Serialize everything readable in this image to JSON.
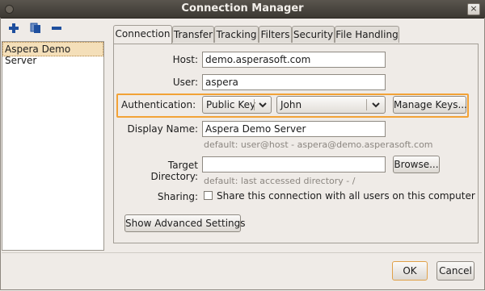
{
  "window": {
    "title": "Connection Manager",
    "close_glyph": "×"
  },
  "toolbar": {
    "icons": [
      "add-icon",
      "duplicate-icon",
      "remove-icon"
    ],
    "icon_color": "#1f4f9e"
  },
  "servers": [
    "Aspera Demo Server"
  ],
  "tabs": [
    "Connection",
    "Transfer",
    "Tracking",
    "Filters",
    "Security",
    "File Handling"
  ],
  "form": {
    "host_label": "Host:",
    "host_value": "demo.asperasoft.com",
    "user_label": "User:",
    "user_value": "aspera",
    "auth_label": "Authentication:",
    "auth_type": "Public Key",
    "auth_key": "John",
    "manage_keys": "Manage Keys...",
    "display_name_label": "Display Name:",
    "display_name_value": "Aspera Demo Server",
    "display_name_hint": "default: user@host - aspera@demo.asperasoft.com",
    "target_dir_label": "Target Directory:",
    "target_dir_value": "",
    "browse": "Browse...",
    "target_dir_hint": "default: last accessed directory - /",
    "sharing_label": "Sharing:",
    "sharing_text": "Share this connection with all users on this computer",
    "sharing_checked": false,
    "advanced": "Show Advanced Settings",
    "highlight_color": "#f2a236"
  },
  "footer": {
    "ok": "OK",
    "cancel": "Cancel"
  }
}
